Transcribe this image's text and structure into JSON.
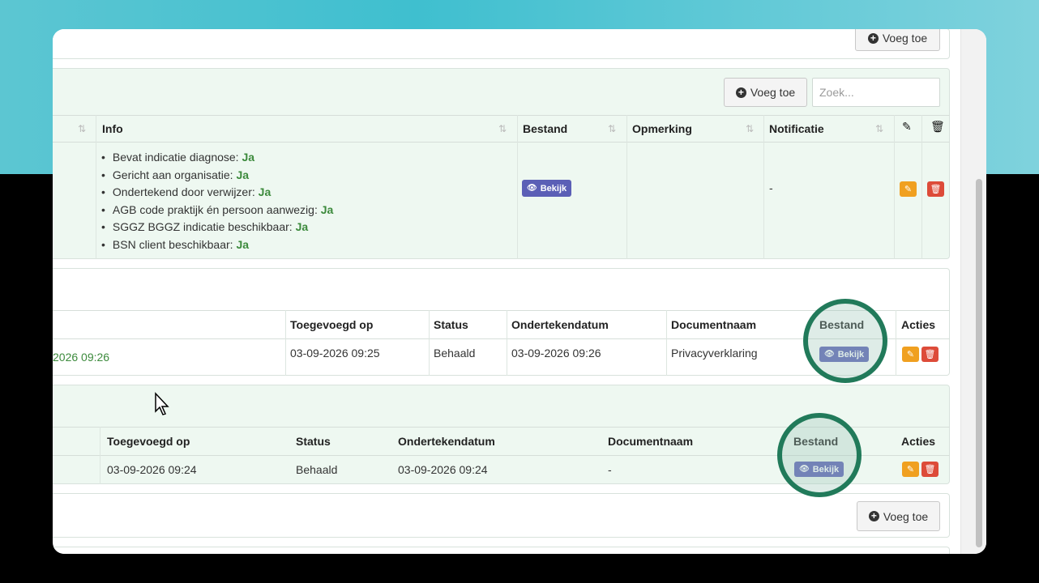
{
  "buttons": {
    "add": "Voeg toe"
  },
  "search": {
    "placeholder": "Zoek..."
  },
  "indication_table": {
    "headers": {
      "info": "Info",
      "file": "Bestand",
      "remark": "Opmerking",
      "notification": "Notificatie"
    },
    "info_items": [
      {
        "label": "Bevat indicatie diagnose:",
        "value": "Ja"
      },
      {
        "label": "Gericht aan organisatie:",
        "value": "Ja"
      },
      {
        "label": "Ondertekend door verwijzer:",
        "value": "Ja"
      },
      {
        "label": "AGB code praktijk én persoon aanwezig:",
        "value": "Ja"
      },
      {
        "label": "SGGZ BGGZ indicatie beschikbaar:",
        "value": "Ja"
      },
      {
        "label": "BSN client beschikbaar:",
        "value": "Ja"
      }
    ],
    "file_button": "Bekijk",
    "notification": "-"
  },
  "privacy_table": {
    "headers": {
      "added_on": "Toegevoegd op",
      "status": "Status",
      "signed_date": "Ondertekendatum",
      "doc_name": "Documentnaam",
      "file": "Bestand",
      "actions": "Acties"
    },
    "row": {
      "first_col": "2026 09:26",
      "added_on": "03-09-2026 09:25",
      "status": "Behaald",
      "signed_date": "03-09-2026 09:26",
      "doc_name": "Privacyverklaring",
      "file": "Bekijk"
    }
  },
  "second_table": {
    "headers": {
      "added_on": "Toegevoegd op",
      "status": "Status",
      "signed_date": "Ondertekendatum",
      "doc_name": "Documentnaam",
      "file": "Bestand",
      "actions": "Acties"
    },
    "row": {
      "added_on": "03-09-2026 09:24",
      "status": "Behaald",
      "signed_date": "03-09-2026 09:24",
      "doc_name": "-",
      "file": "Bekijk"
    }
  },
  "colors": {
    "accent_button": "#5b5fb6",
    "highlight_ring": "#217a5a",
    "edit": "#f0a020",
    "delete": "#dd4b39",
    "ja": "#3c8a3c"
  }
}
